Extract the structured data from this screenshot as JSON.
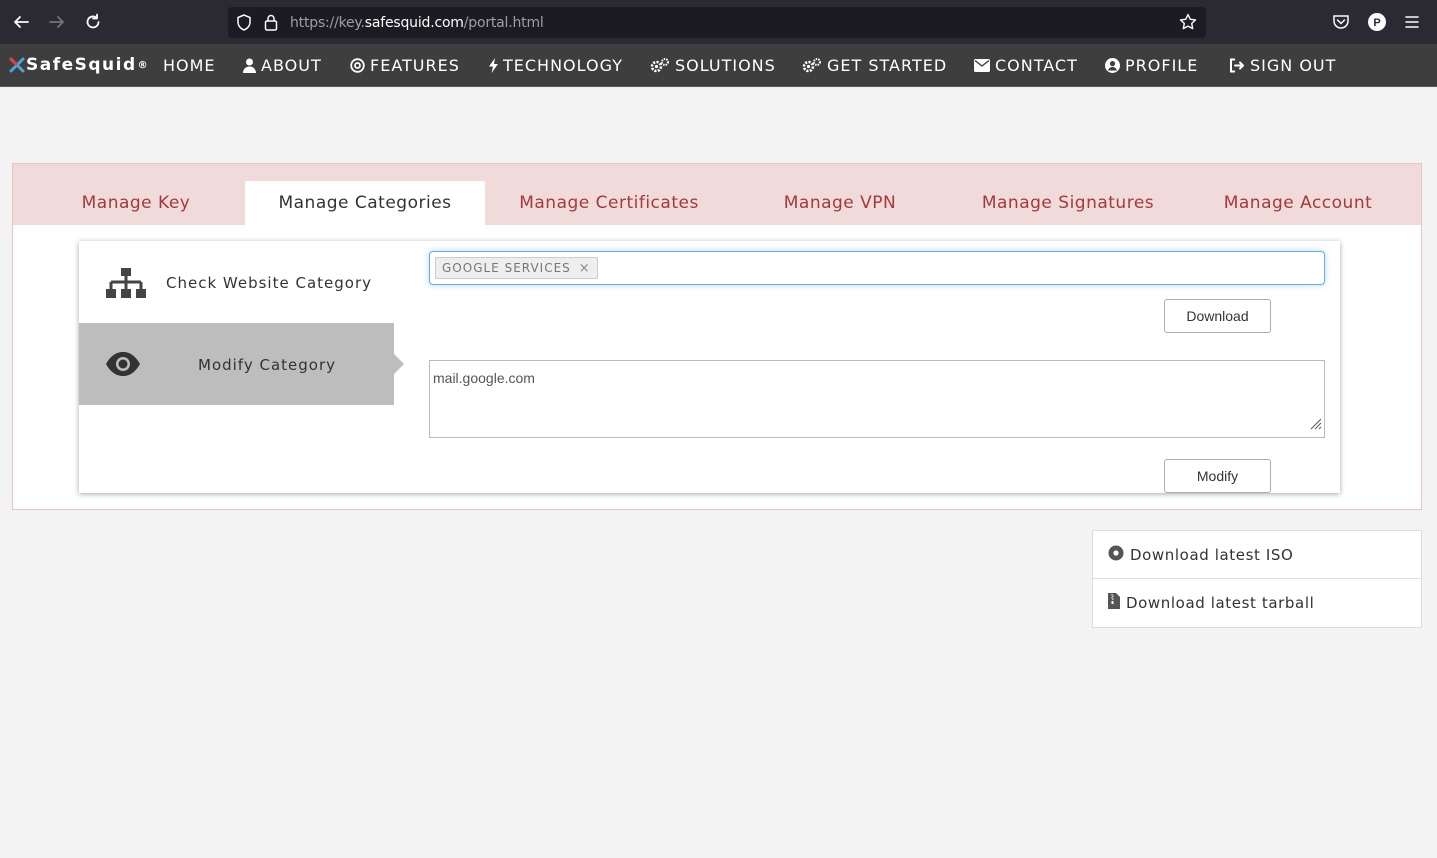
{
  "browser": {
    "url_prefix": "https://key.",
    "url_domain": "safesquid.com",
    "url_path": "/portal.html"
  },
  "nav": {
    "brand": "SafeSquid",
    "brand_mark": "®",
    "items": [
      "HOME",
      "ABOUT",
      "FEATURES",
      "TECHNOLOGY",
      "SOLUTIONS",
      "GET STARTED",
      "CONTACT",
      "PROFILE",
      "SIGN OUT"
    ]
  },
  "tabs": [
    "Manage Key",
    "Manage Categories",
    "Manage Certificates",
    "Manage VPN",
    "Manage Signatures",
    "Manage Account"
  ],
  "sidebar": {
    "items": [
      "Check Website Category",
      "Modify Category"
    ]
  },
  "category": {
    "tag": "GOOGLE SERVICES",
    "tag_remove": "×"
  },
  "buttons": {
    "download": "Download",
    "modify": "Modify"
  },
  "textarea": {
    "value": "mail.google.com"
  },
  "downloads": {
    "iso": "Download latest ISO",
    "tarball": "Download latest tarball"
  },
  "colors": {
    "accent": "#a33a3a",
    "nav_bg": "#3e3e3e",
    "tab_bar_bg": "#f1dada"
  }
}
